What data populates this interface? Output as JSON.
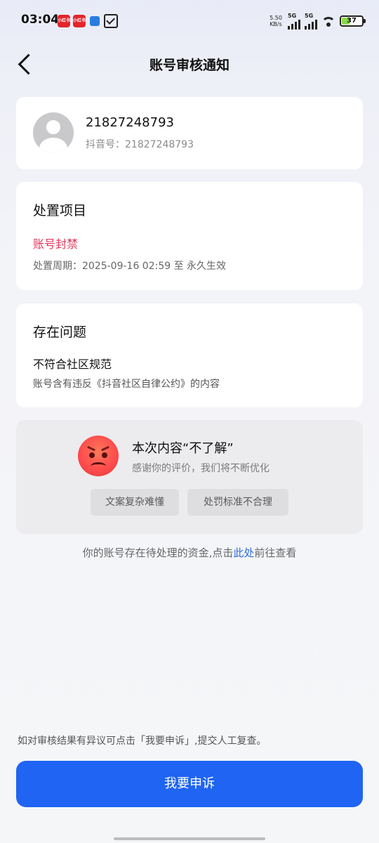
{
  "status_bar": {
    "time": "03:04",
    "notif_app_1": "小红书",
    "notif_app_2": "小红书",
    "net_speed_value": "5.50",
    "net_speed_unit": "KB/s",
    "signal_1": "5G",
    "signal_2": "5G",
    "battery": "37"
  },
  "header": {
    "title": "账号审核通知"
  },
  "account": {
    "name": "21827248793",
    "douyin_id": "抖音号：21827248793"
  },
  "action": {
    "title": "处置项目",
    "type": "账号封禁",
    "period": "处置周期：2025-09-16 02:59 至 永久生效"
  },
  "issue": {
    "title": "存在问题",
    "main": "不符合社区规范",
    "desc": "账号含有违反《抖音社区自律公约》的内容"
  },
  "feedback": {
    "title": "本次内容“不了解”",
    "subtitle": "感谢你的评价，我们将不断优化",
    "options": [
      "文案复杂难懂",
      "处罚标准不合理"
    ]
  },
  "funds": {
    "prefix": "你的账号存在待处理的资金,点击",
    "link": "此处",
    "suffix": "前往查看"
  },
  "appeal": {
    "hint": "如对审核结果有异议可点击「我要申诉」,提交人工复查。",
    "button": "我要申诉"
  },
  "colors": {
    "primary": "#1f64f2",
    "danger": "#e0395a",
    "link": "#2f6bd8"
  }
}
